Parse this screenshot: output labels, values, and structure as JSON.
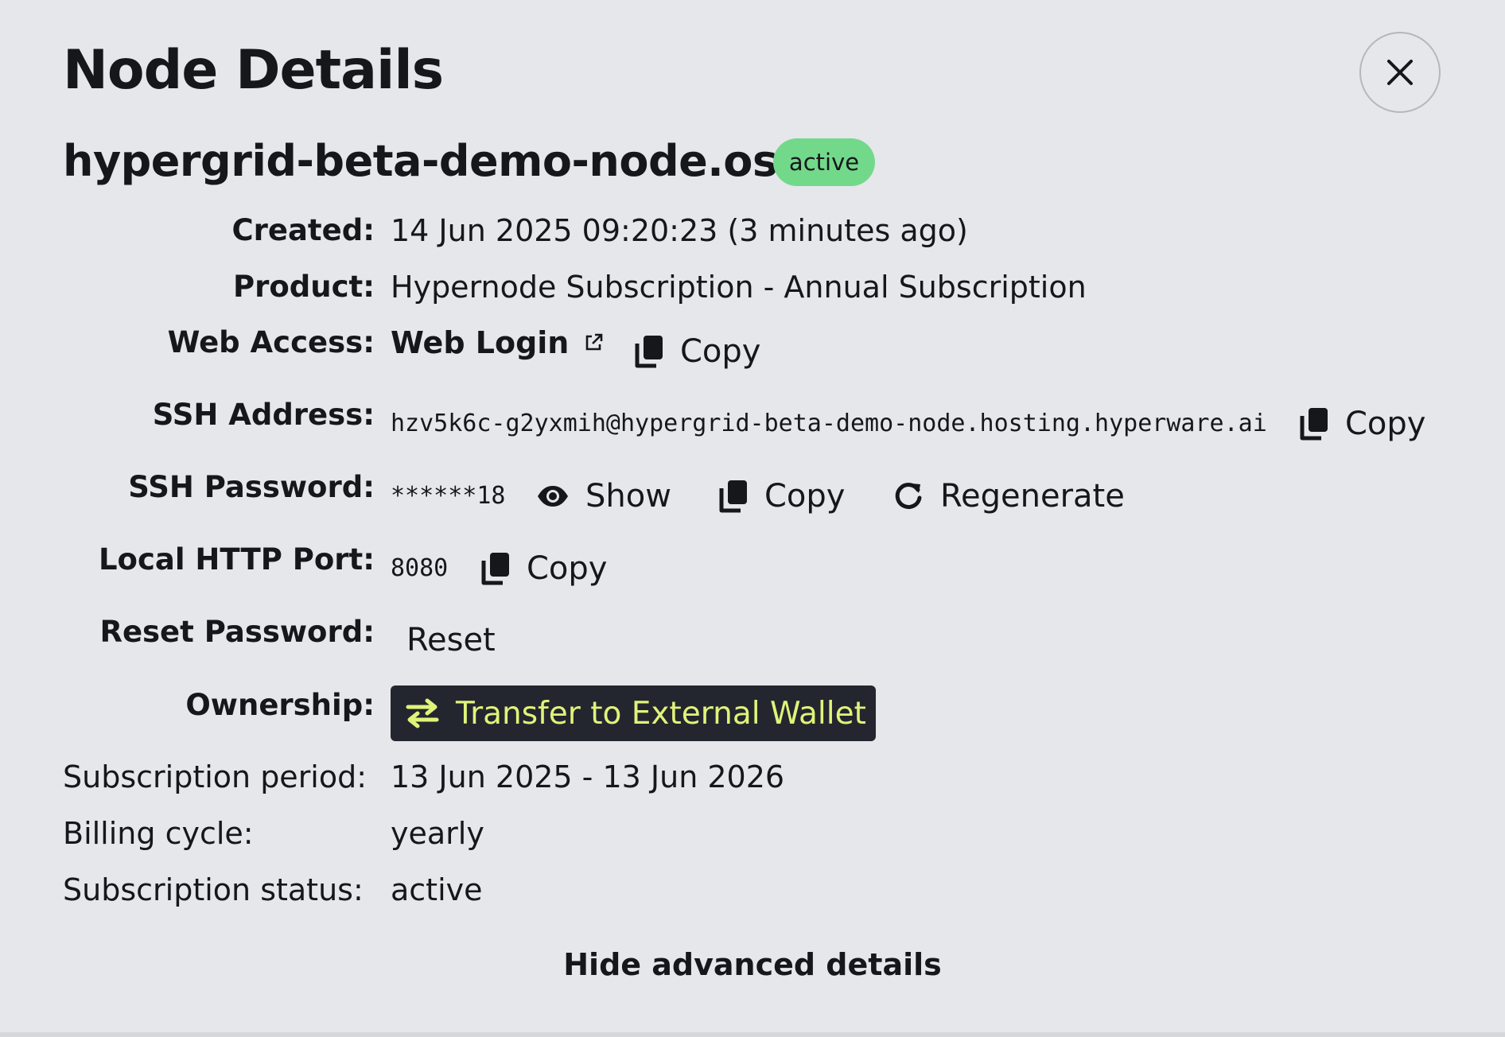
{
  "header": {
    "title": "Node Details"
  },
  "node": {
    "name": "hypergrid-beta-demo-node.os",
    "status": "active"
  },
  "details": {
    "created": {
      "label": "Created:",
      "value": "14 Jun 2025 09:20:23 (3 minutes ago)"
    },
    "product": {
      "label": "Product:",
      "value": "Hypernode Subscription - Annual Subscription"
    },
    "web_access": {
      "label": "Web Access:",
      "link_text": "Web Login",
      "copy_label": "Copy"
    },
    "ssh_address": {
      "label": "SSH Address:",
      "value": "hzv5k6c-g2yxmih@hypergrid-beta-demo-node.hosting.hyperware.ai",
      "copy_label": "Copy"
    },
    "ssh_password": {
      "label": "SSH Password:",
      "value": "******18",
      "show_label": "Show",
      "copy_label": "Copy",
      "regenerate_label": "Regenerate"
    },
    "local_http_port": {
      "label": "Local HTTP Port:",
      "value": "8080",
      "copy_label": "Copy"
    },
    "reset_password": {
      "label": "Reset Password:",
      "button_label": "Reset"
    },
    "ownership": {
      "label": "Ownership:",
      "button_label": "Transfer to External Wallet"
    }
  },
  "subscription": {
    "period": {
      "label": "Subscription period:",
      "value": "13 Jun 2025 - 13 Jun 2026"
    },
    "billing": {
      "label": "Billing cycle:",
      "value": "yearly"
    },
    "status": {
      "label": "Subscription status:",
      "value": "active"
    }
  },
  "footer": {
    "toggle_label": "Hide advanced details"
  },
  "colors": {
    "background": "#e6e7ea",
    "status_active": "#72d98b",
    "transfer_button_bg": "#24262f",
    "transfer_button_text": "#dff37a"
  },
  "icons": [
    "close-icon",
    "external-link-icon",
    "copy-icon",
    "eye-icon",
    "refresh-icon",
    "swap-arrows-icon"
  ]
}
